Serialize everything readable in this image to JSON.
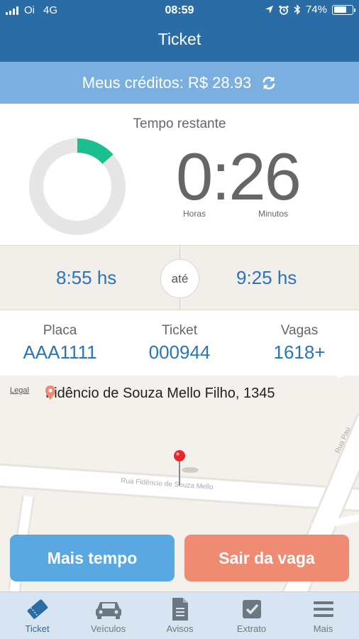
{
  "status_bar": {
    "carrier": "Oi",
    "network": "4G",
    "time": "08:59",
    "battery_percent": "74%",
    "battery_level": 0.74
  },
  "nav": {
    "title": "Ticket"
  },
  "credits": {
    "text": "Meus créditos: R$ 28.93",
    "icon": "refresh-icon"
  },
  "timer": {
    "label": "Tempo restante",
    "time": "0:26",
    "hours_label": "Horas",
    "minutes_label": "Minutos",
    "progress_fraction": 0.133,
    "progress_color": "#1bbf8f",
    "track_color": "#e6e6e6"
  },
  "range": {
    "start": "8:55 hs",
    "separator": "até",
    "end": "9:25 hs"
  },
  "info": [
    {
      "label": "Placa",
      "value": "AAA1111"
    },
    {
      "label": "Ticket",
      "value": "000944"
    },
    {
      "label": "Vagas",
      "value": "1618+"
    }
  ],
  "map": {
    "legal": "Legal",
    "address": "Fidêncio de Souza Mello Filho, 1345",
    "street_label": "Rua Fidêncio de Souza Mello",
    "side_street_label": "Rua Pau"
  },
  "actions": {
    "more_time": "Mais tempo",
    "leave": "Sair da vaga"
  },
  "tabs": [
    {
      "label": "Ticket",
      "icon": "ticket-icon",
      "active": true
    },
    {
      "label": "Veículos",
      "icon": "car-icon",
      "active": false
    },
    {
      "label": "Avisos",
      "icon": "document-icon",
      "active": false
    },
    {
      "label": "Extrato",
      "icon": "checkbox-icon",
      "active": false
    },
    {
      "label": "Mais",
      "icon": "menu-icon",
      "active": false
    }
  ],
  "colors": {
    "header": "#2a6ca5",
    "credits_bar": "#7aafe0",
    "accent_text": "#2a74b9",
    "more_button": "#5aa8e2",
    "leave_button": "#ef8a73"
  }
}
